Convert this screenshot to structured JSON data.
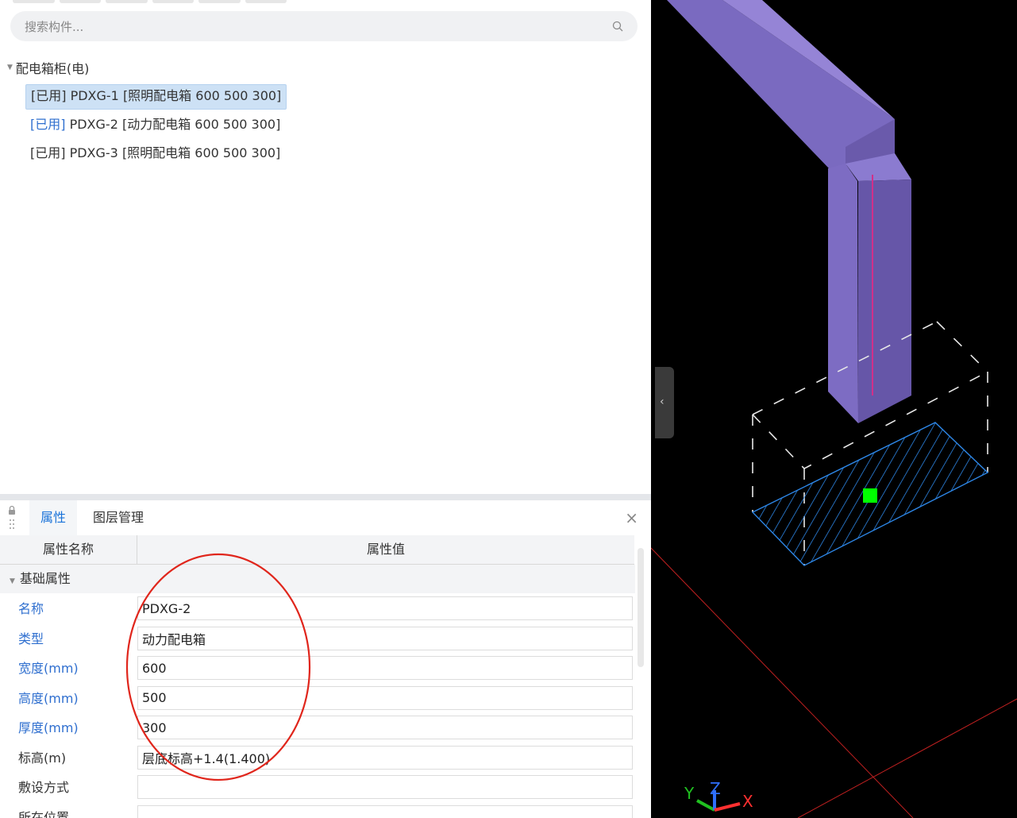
{
  "search": {
    "placeholder": "搜索构件..."
  },
  "tree": {
    "root_label": "配电箱柜(电)",
    "items": [
      {
        "label": "[已用] PDXG-1 [照明配电箱 600 500 300]"
      },
      {
        "tag": "[已用]",
        "label": " PDXG-2 [动力配电箱 600 500 300]"
      },
      {
        "label": "[已用] PDXG-3 [照明配电箱 600 500 300]"
      }
    ]
  },
  "panel": {
    "tabs": [
      {
        "label": "属性"
      },
      {
        "label": "图层管理"
      }
    ],
    "close_label": "×"
  },
  "grid": {
    "col_name": "属性名称",
    "col_value": "属性值",
    "group_label": "基础属性",
    "rows": [
      {
        "name": "名称",
        "value": "PDXG-2"
      },
      {
        "name": "类型",
        "value": "动力配电箱"
      },
      {
        "name": "宽度(mm)",
        "value": "600"
      },
      {
        "name": "高度(mm)",
        "value": "500"
      },
      {
        "name": "厚度(mm)",
        "value": "300"
      },
      {
        "name": "标高(m)",
        "value": "层底标高+1.4(1.400)"
      },
      {
        "name": "敷设方式",
        "value": ""
      },
      {
        "name": "所在位置",
        "value": ""
      }
    ]
  },
  "viewport": {
    "axis_labels": {
      "x": "X",
      "y": "Y",
      "z": "Z"
    },
    "collapse_glyph": "‹"
  },
  "colors": {
    "accent": "#1a73d9",
    "property_blue": "#2f6fcf",
    "annotation_red": "#e0261c",
    "duct_purple": "#8a78c9",
    "hatch_blue": "#2d86e6",
    "marker_green": "#00ff00",
    "viewport_bg": "#000000"
  }
}
